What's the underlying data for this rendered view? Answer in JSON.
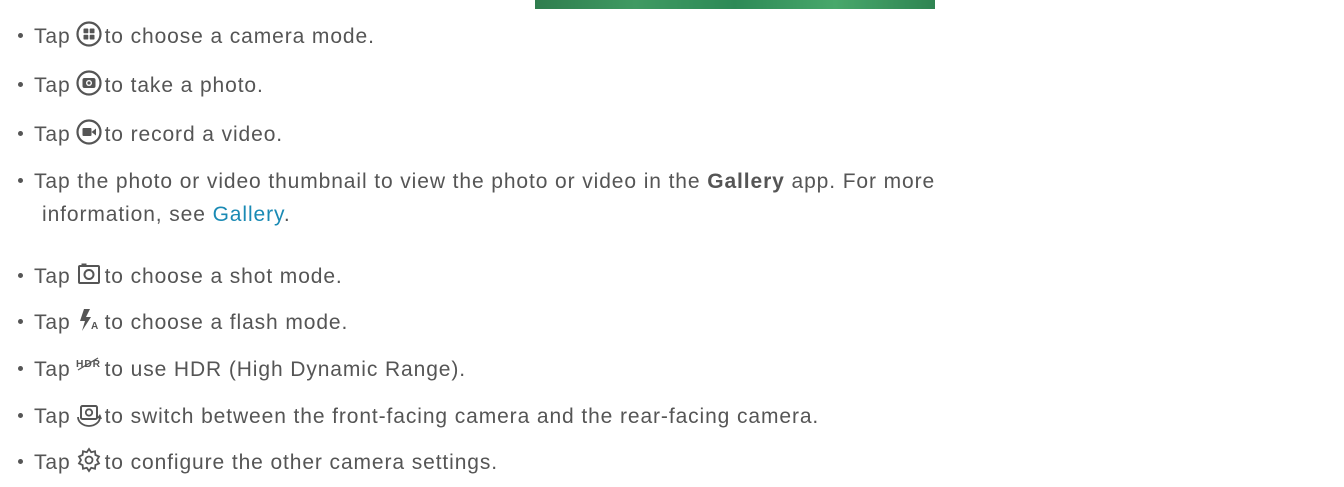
{
  "items": [
    {
      "pre": "Tap",
      "icon": "camera-mode-icon",
      "post": "to choose a camera mode."
    },
    {
      "pre": "Tap",
      "icon": "shutter-icon",
      "post": "to take a photo."
    },
    {
      "pre": "Tap",
      "icon": "video-record-icon",
      "post": "to record a video."
    },
    {
      "pre": "Tap the photo or video thumbnail to view the photo or video in the",
      "bold": "Gallery",
      "mid": "app. For more",
      "line2": "information, see",
      "link": "Gallery",
      "end": "."
    },
    {
      "pre": "Tap",
      "icon": "shot-mode-icon",
      "post": "to choose a shot mode."
    },
    {
      "pre": "Tap",
      "icon": "flash-auto-icon",
      "post": "to choose a flash mode."
    },
    {
      "pre": "Tap",
      "icon": "hdr-icon",
      "post": "to use HDR (High Dynamic Range)."
    },
    {
      "pre": "Tap",
      "icon": "switch-camera-icon",
      "post": "to switch between the front-facing camera and the rear-facing camera."
    },
    {
      "pre": "Tap",
      "icon": "settings-gear-icon",
      "post": "to configure the other camera settings."
    }
  ],
  "colors": {
    "text": "#555555",
    "link": "#1a8ab4"
  }
}
